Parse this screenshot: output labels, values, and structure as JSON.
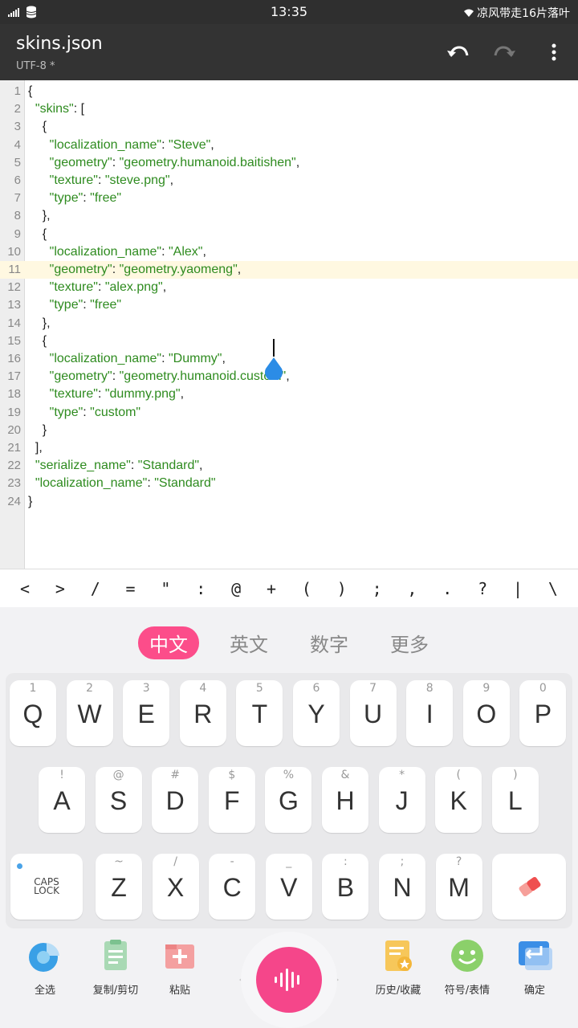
{
  "status_bar": {
    "time": "13:35",
    "right_text": "凉风带走16片落叶"
  },
  "app_bar": {
    "title": "skins.json",
    "subtitle": "UTF-8 *"
  },
  "editor": {
    "lines": [
      {
        "n": "1",
        "indent": "",
        "parts": [
          [
            "p",
            "{"
          ]
        ]
      },
      {
        "n": "2",
        "indent": "  ",
        "parts": [
          [
            "s",
            "\"skins\""
          ],
          [
            "p",
            ": ["
          ]
        ]
      },
      {
        "n": "3",
        "indent": "    ",
        "parts": [
          [
            "p",
            "{"
          ]
        ]
      },
      {
        "n": "4",
        "indent": "      ",
        "parts": [
          [
            "s",
            "\"localization_name\""
          ],
          [
            "p",
            ": "
          ],
          [
            "s",
            "\"Steve\""
          ],
          [
            "p",
            ","
          ]
        ]
      },
      {
        "n": "5",
        "indent": "      ",
        "parts": [
          [
            "s",
            "\"geometry\""
          ],
          [
            "p",
            ": "
          ],
          [
            "s",
            "\"geometry.humanoid.baitishen\""
          ],
          [
            "p",
            ","
          ]
        ]
      },
      {
        "n": "6",
        "indent": "      ",
        "parts": [
          [
            "s",
            "\"texture\""
          ],
          [
            "p",
            ": "
          ],
          [
            "s",
            "\"steve.png\""
          ],
          [
            "p",
            ","
          ]
        ]
      },
      {
        "n": "7",
        "indent": "      ",
        "parts": [
          [
            "s",
            "\"type\""
          ],
          [
            "p",
            ": "
          ],
          [
            "s",
            "\"free\""
          ]
        ]
      },
      {
        "n": "8",
        "indent": "    ",
        "parts": [
          [
            "p",
            "},"
          ]
        ]
      },
      {
        "n": "9",
        "indent": "    ",
        "parts": [
          [
            "p",
            "{"
          ]
        ]
      },
      {
        "n": "10",
        "indent": "      ",
        "parts": [
          [
            "s",
            "\"localization_name\""
          ],
          [
            "p",
            ": "
          ],
          [
            "s",
            "\"Alex\""
          ],
          [
            "p",
            ","
          ]
        ]
      },
      {
        "n": "11",
        "indent": "      ",
        "parts": [
          [
            "s",
            "\"geometry\""
          ],
          [
            "p",
            ": "
          ],
          [
            "s",
            "\"geometry.yaomeng\""
          ],
          [
            "p",
            ","
          ]
        ]
      },
      {
        "n": "12",
        "indent": "      ",
        "parts": [
          [
            "s",
            "\"texture\""
          ],
          [
            "p",
            ": "
          ],
          [
            "s",
            "\"alex.png\""
          ],
          [
            "p",
            ","
          ]
        ]
      },
      {
        "n": "13",
        "indent": "      ",
        "parts": [
          [
            "s",
            "\"type\""
          ],
          [
            "p",
            ": "
          ],
          [
            "s",
            "\"free\""
          ]
        ]
      },
      {
        "n": "14",
        "indent": "    ",
        "parts": [
          [
            "p",
            "},"
          ]
        ]
      },
      {
        "n": "15",
        "indent": "    ",
        "parts": [
          [
            "p",
            "{"
          ]
        ]
      },
      {
        "n": "16",
        "indent": "      ",
        "parts": [
          [
            "s",
            "\"localization_name\""
          ],
          [
            "p",
            ": "
          ],
          [
            "s",
            "\"Dummy\""
          ],
          [
            "p",
            ","
          ]
        ]
      },
      {
        "n": "17",
        "indent": "      ",
        "parts": [
          [
            "s",
            "\"geometry\""
          ],
          [
            "p",
            ": "
          ],
          [
            "s",
            "\"geometry.humanoid.custom\""
          ],
          [
            "p",
            ","
          ]
        ]
      },
      {
        "n": "18",
        "indent": "      ",
        "parts": [
          [
            "s",
            "\"texture\""
          ],
          [
            "p",
            ": "
          ],
          [
            "s",
            "\"dummy.png\""
          ],
          [
            "p",
            ","
          ]
        ]
      },
      {
        "n": "19",
        "indent": "      ",
        "parts": [
          [
            "s",
            "\"type\""
          ],
          [
            "p",
            ": "
          ],
          [
            "s",
            "\"custom\""
          ]
        ]
      },
      {
        "n": "20",
        "indent": "    ",
        "parts": [
          [
            "p",
            "}"
          ]
        ]
      },
      {
        "n": "21",
        "indent": "  ",
        "parts": [
          [
            "p",
            "],"
          ]
        ]
      },
      {
        "n": "22",
        "indent": "  ",
        "parts": [
          [
            "s",
            "\"serialize_name\""
          ],
          [
            "p",
            ": "
          ],
          [
            "s",
            "\"Standard\""
          ],
          [
            "p",
            ","
          ]
        ]
      },
      {
        "n": "23",
        "indent": "  ",
        "parts": [
          [
            "s",
            "\"localization_name\""
          ],
          [
            "p",
            ": "
          ],
          [
            "s",
            "\"Standard\""
          ]
        ]
      },
      {
        "n": "24",
        "indent": "",
        "parts": [
          [
            "p",
            "}"
          ]
        ]
      }
    ],
    "active_line": 11
  },
  "symbols": [
    "<",
    ">",
    "/",
    "=",
    "\"",
    ":",
    "@",
    "+",
    "(",
    ")",
    ";",
    ",",
    ".",
    "?",
    "|",
    "\\"
  ],
  "lang_tabs": [
    "中文",
    "英文",
    "数字",
    "更多"
  ],
  "keys": {
    "row1": [
      [
        "1",
        "Q"
      ],
      [
        "2",
        "W"
      ],
      [
        "3",
        "E"
      ],
      [
        "4",
        "R"
      ],
      [
        "5",
        "T"
      ],
      [
        "6",
        "Y"
      ],
      [
        "7",
        "U"
      ],
      [
        "8",
        "I"
      ],
      [
        "9",
        "O"
      ],
      [
        "0",
        "P"
      ]
    ],
    "row2": [
      [
        "!",
        "A"
      ],
      [
        "@",
        "S"
      ],
      [
        "#",
        "D"
      ],
      [
        "$",
        "F"
      ],
      [
        "%",
        "G"
      ],
      [
        "&",
        "H"
      ],
      [
        "*",
        "J"
      ],
      [
        "(",
        "K"
      ],
      [
        ")",
        "L"
      ]
    ],
    "row3": [
      [
        "~",
        "Z"
      ],
      [
        "/",
        "X"
      ],
      [
        "-",
        "C"
      ],
      [
        "_",
        "V"
      ],
      [
        ":",
        "B"
      ],
      [
        ";",
        "N"
      ],
      [
        "?",
        "M"
      ]
    ],
    "caps_line1": "CAPS",
    "caps_line2": "LOCK"
  },
  "toolbar": {
    "select_all": "全选",
    "copy_cut": "复制/剪切",
    "paste": "粘贴",
    "history": "历史/收藏",
    "symbols": "符号/表情",
    "confirm": "确定"
  },
  "colors": {
    "accent": "#fc4d8a",
    "string": "#2e8b1f",
    "appbar": "#333333"
  }
}
